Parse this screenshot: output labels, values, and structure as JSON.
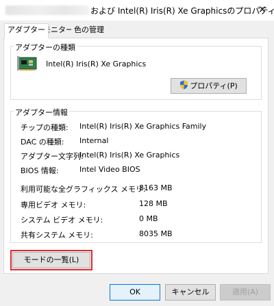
{
  "window": {
    "title": "および Intel(R) Iris(R) Xe Graphicsのプロパティ",
    "close_glyph": "✕"
  },
  "tabs": [
    {
      "label": "アダプター",
      "active": true
    },
    {
      "label": "モニター",
      "active": false
    },
    {
      "label": "色の管理",
      "active": false
    }
  ],
  "adapter_type": {
    "group_label": "アダプターの種類",
    "adapter_name": "Intel(R) Iris(R) Xe Graphics",
    "properties_button": "プロパティ(P)",
    "properties_icon": "uac-shield-icon"
  },
  "adapter_info": {
    "group_label": "アダプター情報",
    "rows": [
      {
        "label": "チップの種類:",
        "value": "Intel(R) Iris(R) Xe Graphics Family"
      },
      {
        "label": "DAC の種類:",
        "value": "Internal"
      },
      {
        "label": "アダプター文字列:",
        "value": "Intel(R) Iris(R) Xe Graphics"
      },
      {
        "label": "BIOS 情報:",
        "value": "Intel Video BIOS"
      }
    ],
    "memory_rows": [
      {
        "label": "利用可能な全グラフィックス メモリ:",
        "value": "8163 MB"
      },
      {
        "label": "専用ビデオ メモリ:",
        "value": "128 MB"
      },
      {
        "label": "システム ビデオ メモリ:",
        "value": "0 MB"
      },
      {
        "label": "共有システム メモリ:",
        "value": "8035 MB"
      }
    ]
  },
  "list_modes_button": "モードの一覧(L)",
  "footer": {
    "ok": "OK",
    "cancel": "キャンセル",
    "apply": "適用(A)"
  },
  "colors": {
    "highlight": "#e0282f",
    "focus_border": "#0078d7",
    "disabled_text": "#a0a0a0"
  }
}
